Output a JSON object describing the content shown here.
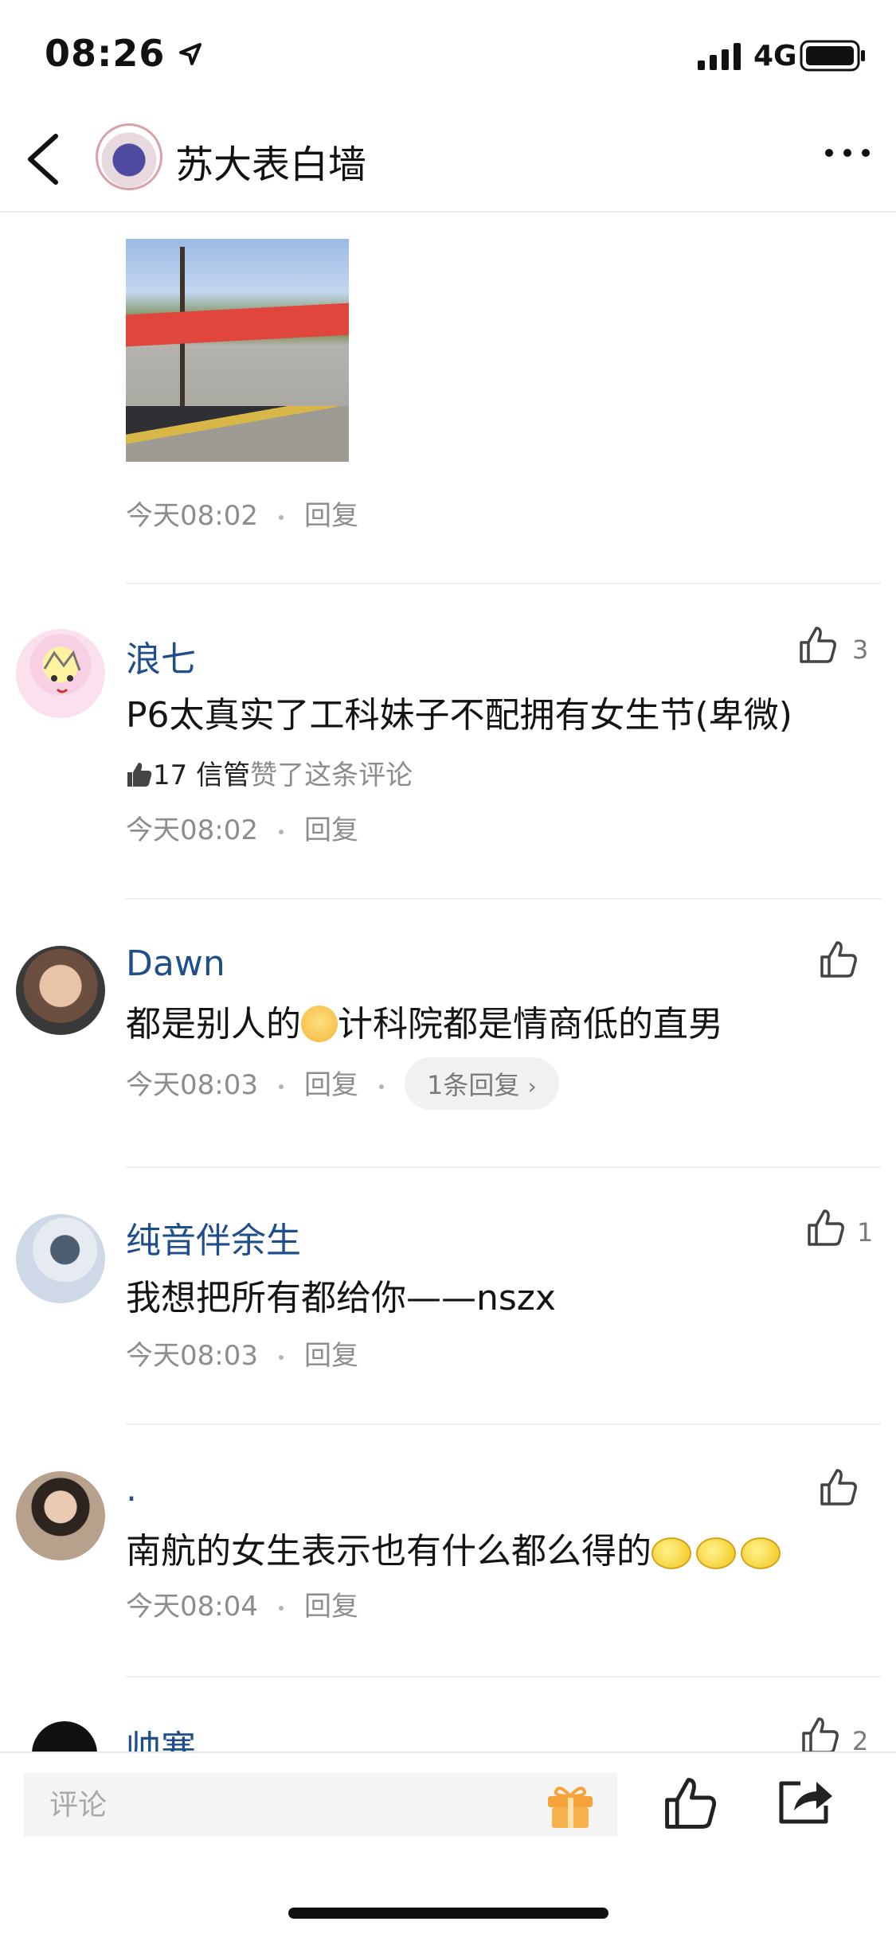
{
  "status_bar": {
    "time": "08:26",
    "network": "4G"
  },
  "header": {
    "title": "苏大表白墙"
  },
  "post_footer": {
    "time": "今天08:02",
    "reply": "回复"
  },
  "comments": [
    {
      "username": "浪七",
      "text": "P6太真实了工科妹子不配拥有女生节(卑微)",
      "likes": "3",
      "liked_by_count": "17",
      "liked_by_name": "信管",
      "liked_by_suffix": "赞了这条评论",
      "time": "今天08:02",
      "reply": "回复"
    },
    {
      "username": "Dawn",
      "text_before": "都是别人的",
      "text_after": "计科院都是情商低的直男",
      "time": "今天08:03",
      "reply": "回复",
      "replies": "1条回复"
    },
    {
      "username": "纯音伴余生",
      "text": "我想把所有都给你——nszx",
      "likes": "1",
      "time": "今天08:03",
      "reply": "回复"
    },
    {
      "username": ".",
      "text": "南航的女生表示也有什么都么得的",
      "time": "今天08:04",
      "reply": "回复"
    },
    {
      "username": "帅寒",
      "likes": "2"
    }
  ],
  "bottom_bar": {
    "comment_placeholder": "评论"
  },
  "icons": {
    "back": "back-arrow-icon",
    "more": "more-icon",
    "like": "thumbs-up-icon",
    "gift": "gift-icon",
    "share": "share-icon"
  },
  "colors": {
    "username": "#1f4e8c",
    "meta": "#8d8d8d",
    "gift": "#f6a33a"
  }
}
